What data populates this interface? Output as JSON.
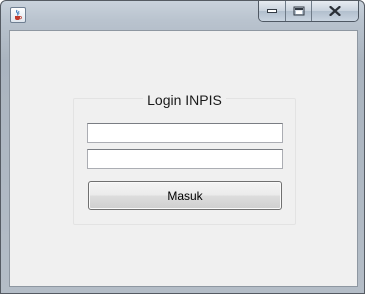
{
  "window": {
    "icon": "java-cup-icon",
    "controls": [
      "minimize-icon",
      "maximize-icon",
      "close-icon"
    ]
  },
  "login": {
    "title": "Login INPIS",
    "username_value": "",
    "password_value": "",
    "submit_label": "Masuk"
  }
}
